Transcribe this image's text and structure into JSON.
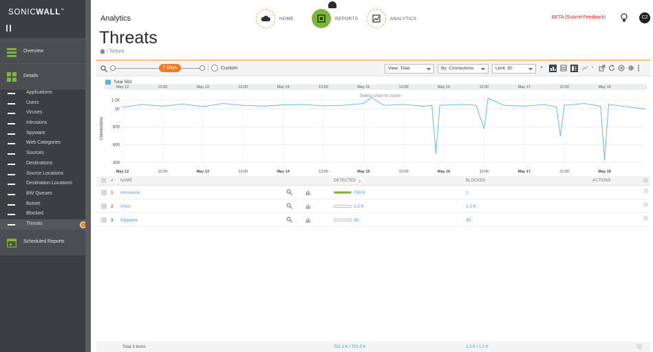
{
  "brand": {
    "name_light": "SONIC",
    "name_bold": "WALL",
    "tm": "™"
  },
  "sidebar": {
    "overview_label": "Overview",
    "details_label": "Details",
    "items": [
      {
        "label": "Applications"
      },
      {
        "label": "Users"
      },
      {
        "label": "Viruses"
      },
      {
        "label": "Intrusions"
      },
      {
        "label": "Spyware"
      },
      {
        "label": "Web Categories"
      },
      {
        "label": "Sources"
      },
      {
        "label": "Destinations"
      },
      {
        "label": "Source Locations"
      },
      {
        "label": "Destination Locations"
      },
      {
        "label": "BW Queues"
      },
      {
        "label": "Botnet"
      },
      {
        "label": "Blocked"
      },
      {
        "label": "Threats"
      }
    ],
    "active_item": "Threats",
    "scheduled_label": "Scheduled Reports"
  },
  "header": {
    "app_title": "Analytics",
    "page_title": "Threats",
    "breadcrumb": "/ Torture",
    "nav": [
      {
        "label": "HOME"
      },
      {
        "label": "REPORTS"
      },
      {
        "label": "ANALYTICS"
      }
    ],
    "beta_link": "BETA (Submit Feedback)",
    "avatar_initials": "C2"
  },
  "toolbar": {
    "range_label": "7 Days",
    "custom_label": "Custom",
    "view_select": "View: Total",
    "by_select": "By: Connections",
    "limit_select": "Limit: 50",
    "plus_label": "+"
  },
  "chart_data": {
    "type": "line",
    "title": "",
    "legend": "Total 583",
    "hint": "Select chart to zoom",
    "ylabel": "Connections",
    "yticks": [
      "1.1K",
      "1K",
      "800",
      "600",
      "400"
    ],
    "ylim": [
      380,
      1180
    ],
    "xlim": [
      0,
      6.5
    ],
    "xticks": [
      "May 12",
      "12:00",
      "May 13",
      "12:00",
      "May 14",
      "12:00",
      "May 15",
      "12:00",
      "May 16",
      "12:00",
      "May 17",
      "12:00",
      "May 18"
    ],
    "series": [
      {
        "values": [
          [
            0.0,
            1020
          ],
          [
            0.25,
            1050
          ],
          [
            0.5,
            1030
          ],
          [
            0.75,
            1055
          ],
          [
            1.0,
            1025
          ],
          [
            1.25,
            1060
          ],
          [
            1.5,
            1040
          ],
          [
            1.75,
            1030
          ],
          [
            2.0,
            1045
          ],
          [
            2.25,
            1050
          ],
          [
            2.5,
            1035
          ],
          [
            2.75,
            1040
          ],
          [
            3.0,
            1060
          ],
          [
            3.1,
            1130
          ],
          [
            3.25,
            1040
          ],
          [
            3.5,
            1050
          ],
          [
            3.75,
            1030
          ],
          [
            3.85,
            1040
          ],
          [
            3.9,
            500
          ],
          [
            3.95,
            1040
          ],
          [
            4.25,
            1050
          ],
          [
            4.4,
            1040
          ],
          [
            4.5,
            780
          ],
          [
            4.55,
            1120
          ],
          [
            4.75,
            1040
          ],
          [
            5.0,
            1030
          ],
          [
            5.25,
            1050
          ],
          [
            5.4,
            1020
          ],
          [
            5.45,
            700
          ],
          [
            5.5,
            1040
          ],
          [
            5.75,
            1060
          ],
          [
            5.95,
            1030
          ],
          [
            6.0,
            430
          ],
          [
            6.05,
            1050
          ],
          [
            6.5,
            1000
          ]
        ]
      }
    ]
  },
  "table": {
    "columns": [
      "#",
      "NAME",
      "DETECTED",
      "BLOCKED",
      "ACTIONS"
    ],
    "rows": [
      {
        "num": "1",
        "name": "Intrusions",
        "detected": "700 K",
        "blocked": "1",
        "fill": 1.0
      },
      {
        "num": "2",
        "name": "Virus",
        "detected": "1.2 K",
        "blocked": "1.2 K",
        "fill": 0.0
      },
      {
        "num": "3",
        "name": "Spyware",
        "detected": "35",
        "blocked": "35",
        "fill": 0.0
      }
    ],
    "footer": {
      "total": "Total 3 items",
      "detected": "701.3 K / 701.3 K",
      "blocked": "1.2 K / 1.2 K"
    }
  },
  "colors": {
    "accent": "#f08a24",
    "series": "#55b5e0",
    "link": "#3c9be0",
    "active_nav": "#7db53b",
    "beta": "#d9262a"
  }
}
